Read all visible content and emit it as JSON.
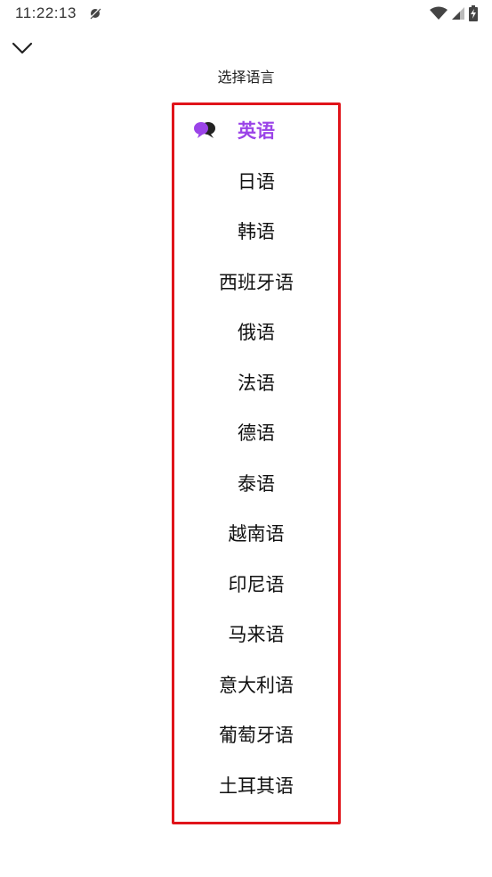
{
  "status": {
    "time": "11:22:13"
  },
  "header": {
    "title": "选择语言"
  },
  "colors": {
    "accent": "#9b44e8",
    "highlight_border": "#e0141a"
  },
  "languages": [
    {
      "label": "英语",
      "selected": true
    },
    {
      "label": "日语"
    },
    {
      "label": "韩语"
    },
    {
      "label": "西班牙语"
    },
    {
      "label": "俄语"
    },
    {
      "label": "法语"
    },
    {
      "label": "德语"
    },
    {
      "label": "泰语"
    },
    {
      "label": "越南语"
    },
    {
      "label": "印尼语"
    },
    {
      "label": "马来语"
    },
    {
      "label": "意大利语"
    },
    {
      "label": "葡萄牙语"
    },
    {
      "label": "土耳其语"
    }
  ]
}
